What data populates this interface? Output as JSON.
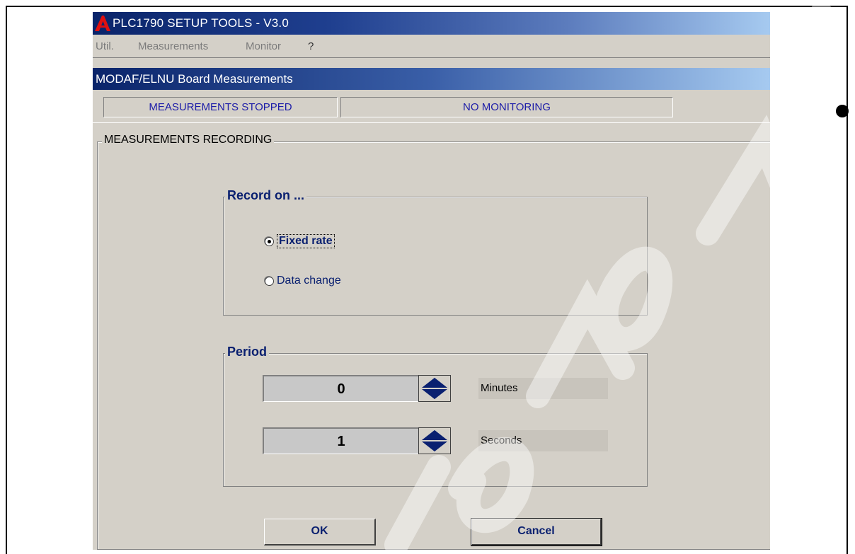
{
  "window": {
    "title": "PLC1790 SETUP TOOLS  -  V3.0",
    "logo_icon": "app-logo-icon"
  },
  "menu": {
    "items": [
      "Util.",
      "Measurements",
      "Monitor",
      "?"
    ]
  },
  "child_window": {
    "title": "MODAF/ELNU Board Measurements"
  },
  "status": {
    "measurements": "MEASUREMENTS STOPPED",
    "monitoring": "NO MONITORING"
  },
  "recording": {
    "title": "MEASUREMENTS RECORDING",
    "record_on": {
      "title": "Record on ...",
      "options": [
        {
          "label": "Fixed rate",
          "checked": true
        },
        {
          "label": "Data change",
          "checked": false
        }
      ]
    },
    "period": {
      "title": "Period",
      "minutes_value": "0",
      "minutes_label": "Minutes",
      "seconds_value": "1",
      "seconds_label": "Seconds"
    }
  },
  "buttons": {
    "ok": "OK",
    "cancel": "Cancel"
  },
  "colors": {
    "title_gradient_start": "#0a246a",
    "title_gradient_end": "#a6caf0",
    "label_blue": "#0a2070",
    "status_text": "#1c1ca8",
    "dialog_face": "#d4d0c8"
  }
}
